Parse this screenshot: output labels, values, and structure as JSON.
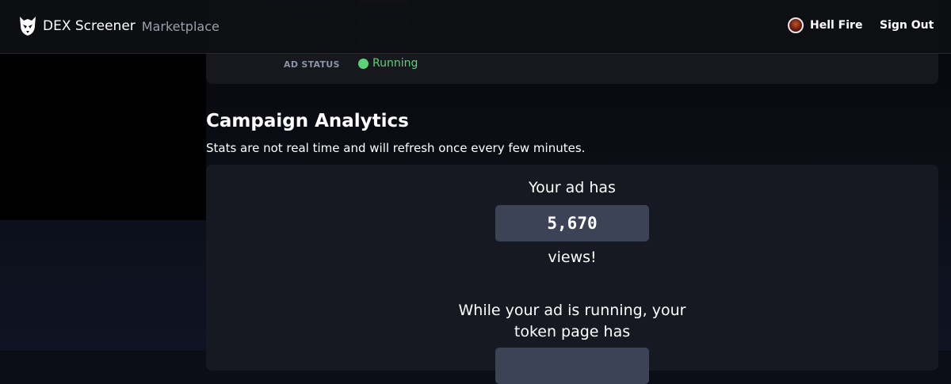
{
  "header": {
    "brand": "DEX Screener",
    "brand_suffix": "Marketplace",
    "user_name": "Hell Fire",
    "sign_out": "Sign Out"
  },
  "ad_details": {
    "status_label": "AD STATUS",
    "status_value": "Running",
    "status_color": "#5bd17a"
  },
  "analytics": {
    "title": "Campaign Analytics",
    "description": "Stats are not real time and will refresh once every few minutes.",
    "views_prefix": "Your ad has",
    "views_count": "5,670",
    "views_suffix": "views!",
    "token_page_text": "While your ad is running, your token page has"
  },
  "colors": {
    "background": "#0b0e16",
    "card": "#161922",
    "stat_box": "#3d4357",
    "accent_green": "#5bd17a"
  }
}
